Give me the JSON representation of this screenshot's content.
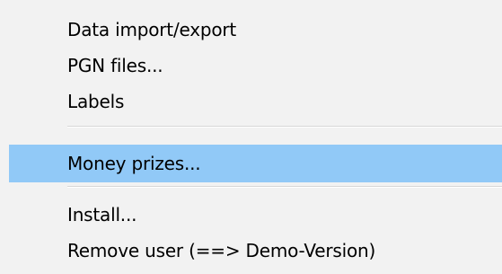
{
  "menu": {
    "items": [
      {
        "label": "Data import/export"
      },
      {
        "label": "PGN files..."
      },
      {
        "label": "Labels"
      },
      {
        "label": "Money prizes..."
      },
      {
        "label": "Install..."
      },
      {
        "label": "Remove user (==> Demo-Version)"
      }
    ],
    "highlighted_item": "Money prizes...",
    "colors": {
      "background": "#f2f2f2",
      "highlight": "#91c9f7",
      "separator": "#d7d7d7",
      "text": "#000000"
    }
  }
}
